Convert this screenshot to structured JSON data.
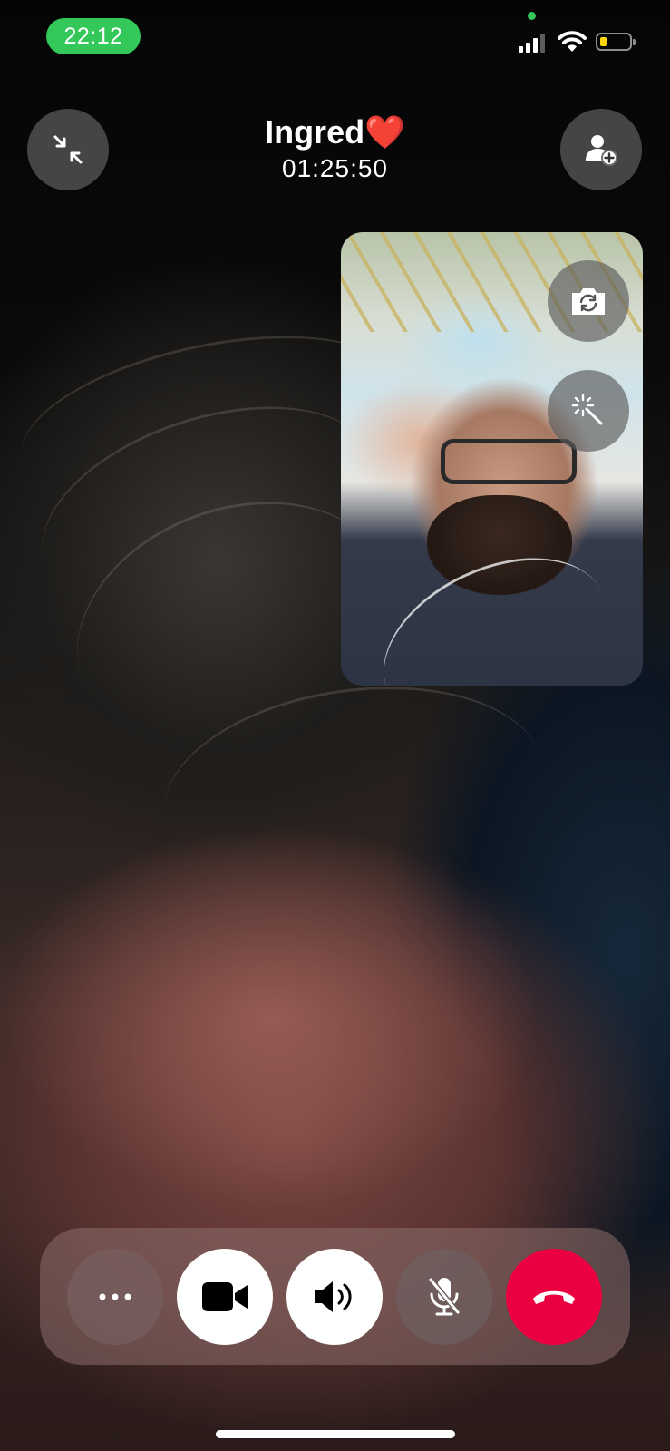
{
  "status_bar": {
    "time": "22:12",
    "icons": [
      "signal-icon",
      "wifi-icon",
      "battery-icon"
    ],
    "time_pill_color": "#34c759",
    "camera_indicator_color": "#34c759",
    "battery_fill_color": "#ffd60a"
  },
  "call": {
    "contact_name": "Ingred❤️",
    "duration": "01:25:50"
  },
  "header_buttons": {
    "minimize": "minimize-arrows-icon",
    "add_person": "add-person-icon"
  },
  "self_view": {
    "buttons": [
      "camera-flip-icon",
      "effects-wand-icon"
    ]
  },
  "controls": {
    "buttons": [
      {
        "name": "more-button",
        "icon": "ellipsis-icon",
        "active": false
      },
      {
        "name": "video-button",
        "icon": "video-camera-icon",
        "active": true
      },
      {
        "name": "speaker-button",
        "icon": "speaker-icon",
        "active": true
      },
      {
        "name": "mute-button",
        "icon": "microphone-slash-icon",
        "active": false
      },
      {
        "name": "end-call-button",
        "icon": "phone-down-icon",
        "color": "#ea0040"
      }
    ]
  }
}
